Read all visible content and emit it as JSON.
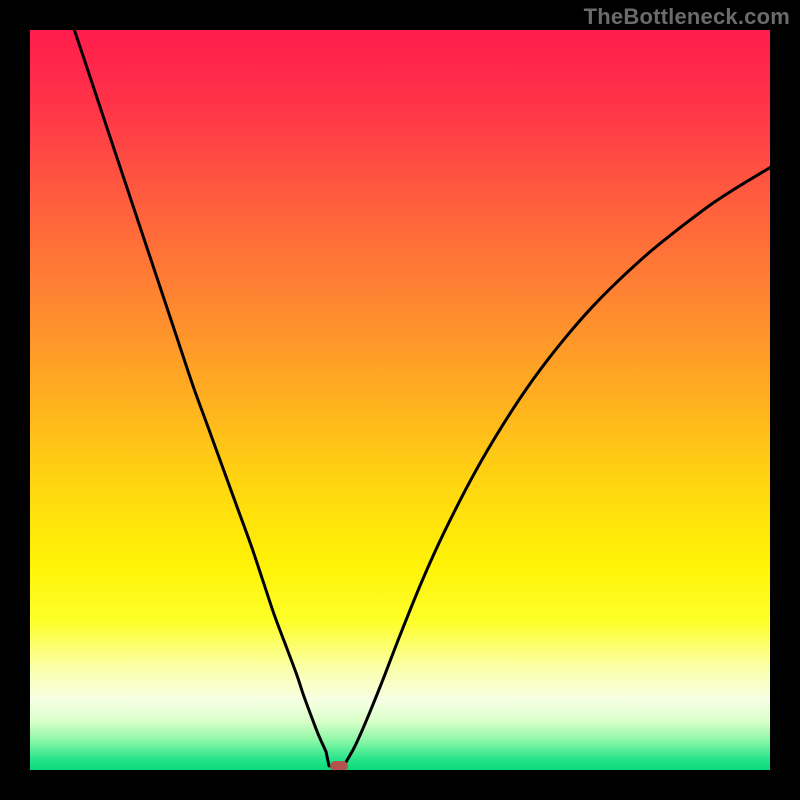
{
  "watermark": "TheBottleneck.com",
  "colors": {
    "black": "#000000",
    "marker": "#b2544d",
    "curve": "#000000"
  },
  "gradient_stops": [
    {
      "offset": 0.0,
      "color": "#ff1c4c"
    },
    {
      "offset": 0.1,
      "color": "#ff3348"
    },
    {
      "offset": 0.22,
      "color": "#ff5a3f"
    },
    {
      "offset": 0.35,
      "color": "#ff8133"
    },
    {
      "offset": 0.5,
      "color": "#ffb01f"
    },
    {
      "offset": 0.62,
      "color": "#ffd80f"
    },
    {
      "offset": 0.72,
      "color": "#fff206"
    },
    {
      "offset": 0.8,
      "color": "#feff2a"
    },
    {
      "offset": 0.86,
      "color": "#fbffa6"
    },
    {
      "offset": 0.905,
      "color": "#f6ffe4"
    },
    {
      "offset": 0.935,
      "color": "#d8ffc8"
    },
    {
      "offset": 0.96,
      "color": "#8bf7a7"
    },
    {
      "offset": 0.985,
      "color": "#29e58b"
    },
    {
      "offset": 1.0,
      "color": "#09d97d"
    }
  ],
  "chart_data": {
    "type": "line",
    "title": "",
    "xlabel": "",
    "ylabel": "",
    "xlim": [
      0,
      100
    ],
    "ylim": [
      0,
      100
    ],
    "series": [
      {
        "name": "bottleneck-curve",
        "x": [
          6,
          8,
          10,
          12,
          14,
          16,
          18,
          20,
          22,
          24,
          26,
          28,
          30,
          31.5,
          33,
          34.5,
          36,
          37,
          38,
          39,
          40,
          40.7,
          41.3,
          42,
          43,
          44,
          46,
          48,
          50,
          53,
          56,
          60,
          64,
          68,
          72,
          76,
          80,
          84,
          88,
          92,
          96,
          100
        ],
        "y": [
          100,
          94,
          88,
          82,
          76,
          70,
          64,
          58,
          52,
          46.5,
          41,
          35.5,
          30,
          25.5,
          21,
          17,
          13,
          10,
          7.3,
          4.7,
          2.5,
          1.2,
          0.6,
          0.6,
          1.6,
          3.4,
          8.0,
          13.0,
          18.2,
          25.6,
          32.2,
          40.0,
          46.8,
          52.8,
          58.0,
          62.6,
          66.6,
          70.2,
          73.4,
          76.4,
          79.0,
          81.4
        ]
      }
    ],
    "marker_point": {
      "x": 41.8,
      "y": 0.6
    },
    "flat_segment": {
      "x0": 40.4,
      "x1": 42.4,
      "y": 0.55
    }
  }
}
